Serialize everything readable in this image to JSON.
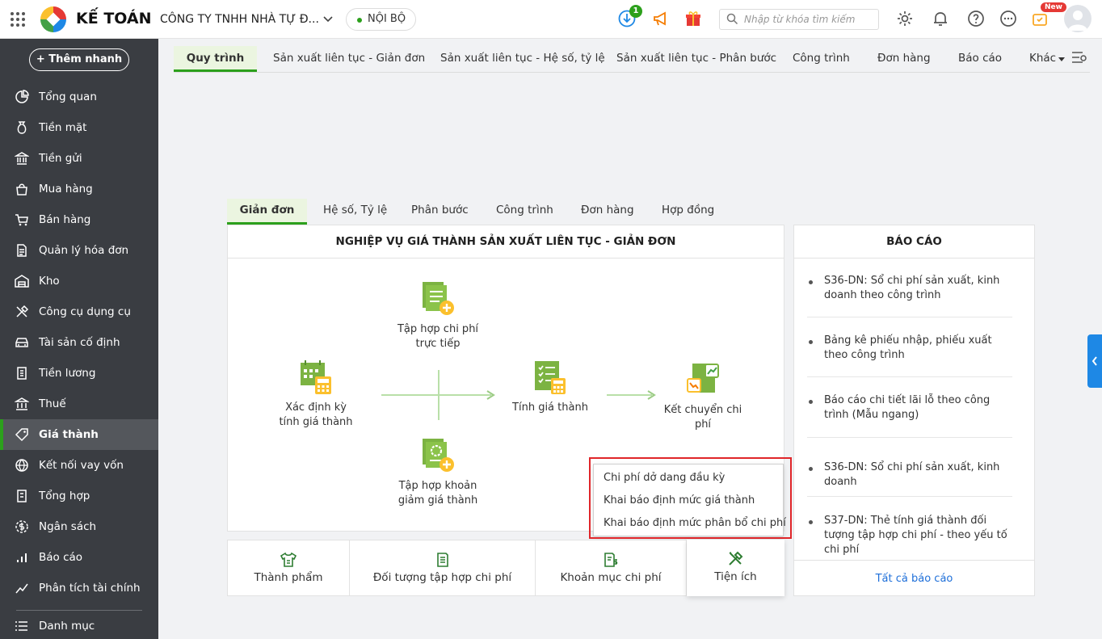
{
  "header": {
    "brand": "KẾ TOÁN",
    "company": "CÔNG TY TNHH NHÀ TỰ Đ...",
    "scope_badge": "NỘI BỘ",
    "download_count": "1",
    "search_placeholder": "Nhập từ khóa tìm kiếm",
    "new_tag": "New"
  },
  "sidebar": {
    "quick_add": "+ Thêm nhanh",
    "items": [
      {
        "label": "Tổng quan",
        "icon": "overview-icon"
      },
      {
        "label": "Tiền mặt",
        "icon": "cash-bag-icon"
      },
      {
        "label": "Tiền gửi",
        "icon": "bank-icon"
      },
      {
        "label": "Mua hàng",
        "icon": "shopping-bag-icon"
      },
      {
        "label": "Bán hàng",
        "icon": "cart-icon"
      },
      {
        "label": "Quản lý hóa đơn",
        "icon": "invoice-icon"
      },
      {
        "label": "Kho",
        "icon": "warehouse-icon"
      },
      {
        "label": "Công cụ dụng cụ",
        "icon": "tools-icon"
      },
      {
        "label": "Tài sản cố định",
        "icon": "car-icon"
      },
      {
        "label": "Tiền lương",
        "icon": "payroll-icon"
      },
      {
        "label": "Thuế",
        "icon": "tax-icon"
      },
      {
        "label": "Giá thành",
        "icon": "price-tag-icon"
      },
      {
        "label": "Kết nối vay vốn",
        "icon": "loan-icon"
      },
      {
        "label": "Tổng hợp",
        "icon": "summary-icon"
      },
      {
        "label": "Ngân sách",
        "icon": "budget-icon"
      },
      {
        "label": "Báo cáo",
        "icon": "report-chart-icon"
      },
      {
        "label": "Phân tích tài chính",
        "icon": "analysis-icon"
      },
      {
        "label": "Danh mục",
        "icon": "list-icon"
      }
    ]
  },
  "main_tabs": [
    "Quy trình",
    "Sản xuất liên tục - Giản đơn",
    "Sản xuất liên tục - Hệ số, tỷ lệ",
    "Sản xuất liên tục - Phân bước",
    "Công trình",
    "Đơn hàng",
    "Báo cáo",
    "Khác"
  ],
  "sub_tabs": [
    "Giản đơn",
    "Hệ số, Tỷ lệ",
    "Phân bước",
    "Công trình",
    "Đơn hàng",
    "Hợp đồng"
  ],
  "process": {
    "title": "NGHIỆP VỤ GIÁ THÀNH SẢN XUẤT LIÊN TỤC - GIẢN ĐƠN",
    "steps": {
      "period": [
        "Xác định kỳ",
        "tính giá thành"
      ],
      "direct": [
        "Tập hợp chi phí",
        "trực tiếp"
      ],
      "reduce": [
        "Tập hợp khoản",
        "giảm giá thành"
      ],
      "calc": [
        "Tính giá thành"
      ],
      "transfer": [
        "Kết chuyển chi",
        "phí"
      ]
    }
  },
  "utility_menu": [
    "Chi phí dở dang đầu kỳ",
    "Khai báo định mức giá thành",
    "Khai báo định mức phân bổ chi phí"
  ],
  "bottom_tabs": [
    "Thành phẩm",
    "Đối tượng tập hợp chi phí",
    "Khoản mục chi phí",
    "Tiện ích"
  ],
  "reports": {
    "title": "BÁO CÁO",
    "items": [
      "S36-DN: Sổ chi phí sản xuất, kinh doanh theo công trình",
      "Bảng kê phiếu nhập, phiếu xuất theo công trình",
      "Báo cáo chi tiết lãi lỗ theo công trình (Mẫu ngang)",
      "S36-DN: Sổ chi phí sản xuất, kinh doanh",
      "S37-DN: Thẻ tính giá thành đối tượng tập hợp chi phí - theo yếu tố chi phí"
    ],
    "all_link": "Tất cả báo cáo"
  },
  "colors": {
    "accent": "#2ca01c",
    "sidebar": "#3a3d42",
    "link": "#1e6fd9",
    "highlight": "#e0262a"
  }
}
